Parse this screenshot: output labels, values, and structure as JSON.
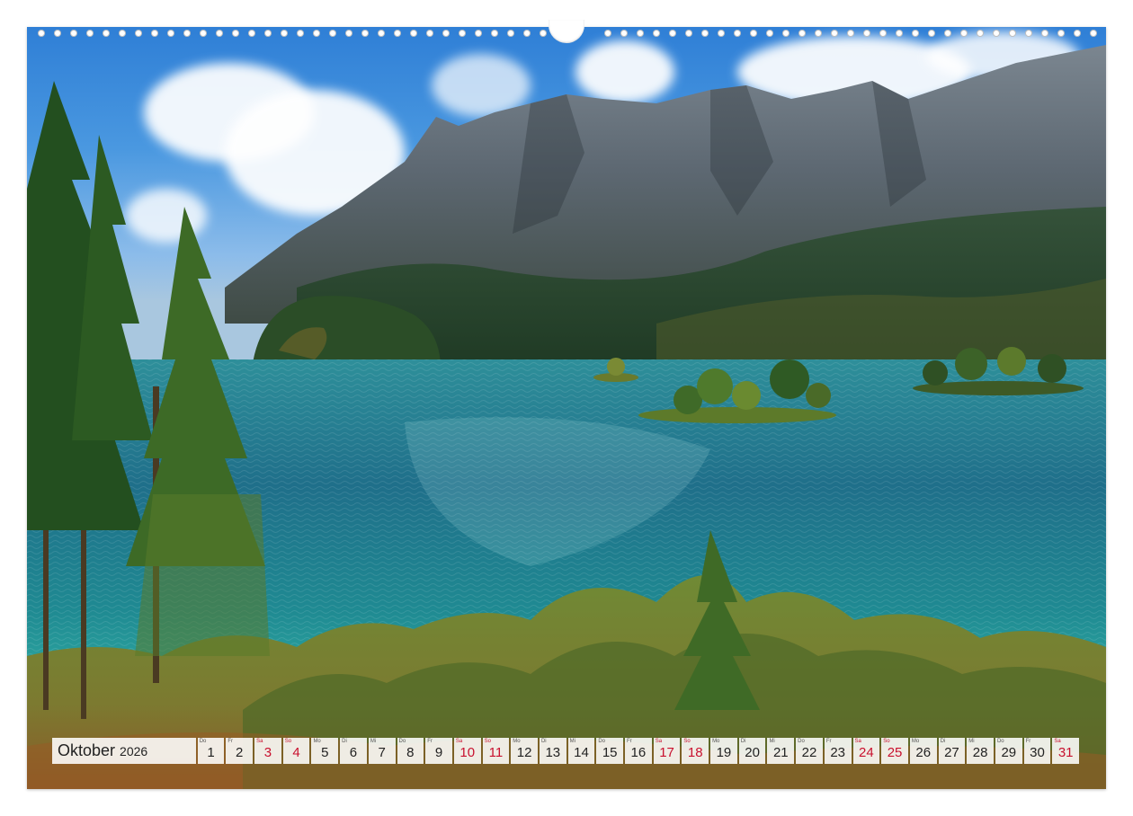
{
  "calendar": {
    "month": "Oktober",
    "year": "2026",
    "days": [
      {
        "wd": "Do",
        "d": "1",
        "weekend": false
      },
      {
        "wd": "Fr",
        "d": "2",
        "weekend": false
      },
      {
        "wd": "Sa",
        "d": "3",
        "weekend": true
      },
      {
        "wd": "So",
        "d": "4",
        "weekend": true
      },
      {
        "wd": "Mo",
        "d": "5",
        "weekend": false
      },
      {
        "wd": "Di",
        "d": "6",
        "weekend": false
      },
      {
        "wd": "Mi",
        "d": "7",
        "weekend": false
      },
      {
        "wd": "Do",
        "d": "8",
        "weekend": false
      },
      {
        "wd": "Fr",
        "d": "9",
        "weekend": false
      },
      {
        "wd": "Sa",
        "d": "10",
        "weekend": true
      },
      {
        "wd": "So",
        "d": "11",
        "weekend": true
      },
      {
        "wd": "Mo",
        "d": "12",
        "weekend": false
      },
      {
        "wd": "Di",
        "d": "13",
        "weekend": false
      },
      {
        "wd": "Mi",
        "d": "14",
        "weekend": false
      },
      {
        "wd": "Do",
        "d": "15",
        "weekend": false
      },
      {
        "wd": "Fr",
        "d": "16",
        "weekend": false
      },
      {
        "wd": "Sa",
        "d": "17",
        "weekend": true
      },
      {
        "wd": "So",
        "d": "18",
        "weekend": true
      },
      {
        "wd": "Mo",
        "d": "19",
        "weekend": false
      },
      {
        "wd": "Di",
        "d": "20",
        "weekend": false
      },
      {
        "wd": "Mi",
        "d": "21",
        "weekend": false
      },
      {
        "wd": "Do",
        "d": "22",
        "weekend": false
      },
      {
        "wd": "Fr",
        "d": "23",
        "weekend": false
      },
      {
        "wd": "Sa",
        "d": "24",
        "weekend": true
      },
      {
        "wd": "So",
        "d": "25",
        "weekend": true
      },
      {
        "wd": "Mo",
        "d": "26",
        "weekend": false
      },
      {
        "wd": "Di",
        "d": "27",
        "weekend": false
      },
      {
        "wd": "Mi",
        "d": "28",
        "weekend": false
      },
      {
        "wd": "Do",
        "d": "29",
        "weekend": false
      },
      {
        "wd": "Fr",
        "d": "30",
        "weekend": false
      },
      {
        "wd": "Sa",
        "d": "31",
        "weekend": true
      }
    ]
  },
  "scene": {
    "subject": "mountain-lake-landscape",
    "colors": {
      "sky": "#3a8ad9",
      "mountain": "#5b6670",
      "forest": "#2d4a2a",
      "lake": "#1f7f8c",
      "turquoise": "#2fb3a8",
      "foliage": "#7a8a3a",
      "weekend": "#c8102e"
    }
  }
}
